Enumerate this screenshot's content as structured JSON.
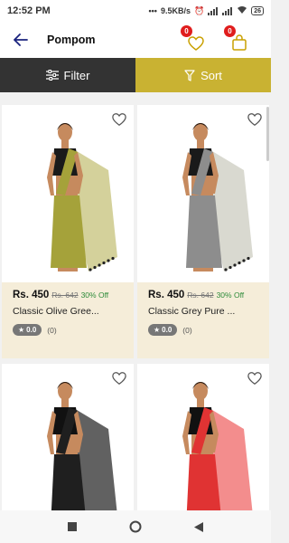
{
  "status": {
    "time": "12:52 PM",
    "net_speed": "9.5KB/s",
    "battery": "26"
  },
  "header": {
    "title": "Pompom",
    "wishlist_count": "0",
    "cart_count": "0"
  },
  "toolbar": {
    "filter_label": "Filter",
    "sort_label": "Sort"
  },
  "products": [
    {
      "price": "Rs. 450",
      "mrp": "Rs. 642",
      "off": "30% Off",
      "name": "Classic Olive Gree...",
      "rating": "0.0",
      "reviews": "(0)",
      "saree_color": "#a5a23a",
      "pallu_color": "#c9c582",
      "blouse_color": "#1a1a1a"
    },
    {
      "price": "Rs. 450",
      "mrp": "Rs. 642",
      "off": "30% Off",
      "name": "Classic Grey Pure ...",
      "rating": "0.0",
      "reviews": "(0)",
      "saree_color": "#8d8d8d",
      "pallu_color": "#cfcfc4",
      "blouse_color": "#1a1a1a"
    },
    {
      "saree_color": "#1f1f1f",
      "pallu_color": "#3a3a3a",
      "blouse_color": "#111111"
    },
    {
      "saree_color": "#e03333",
      "pallu_color": "#f07070",
      "blouse_color": "#111111"
    }
  ],
  "colors": {
    "filter_bg": "#333333",
    "sort_bg": "#c9b232",
    "info_bg": "#f5edd9",
    "discount": "#2e8b3a",
    "badge": "#e01d1d"
  }
}
